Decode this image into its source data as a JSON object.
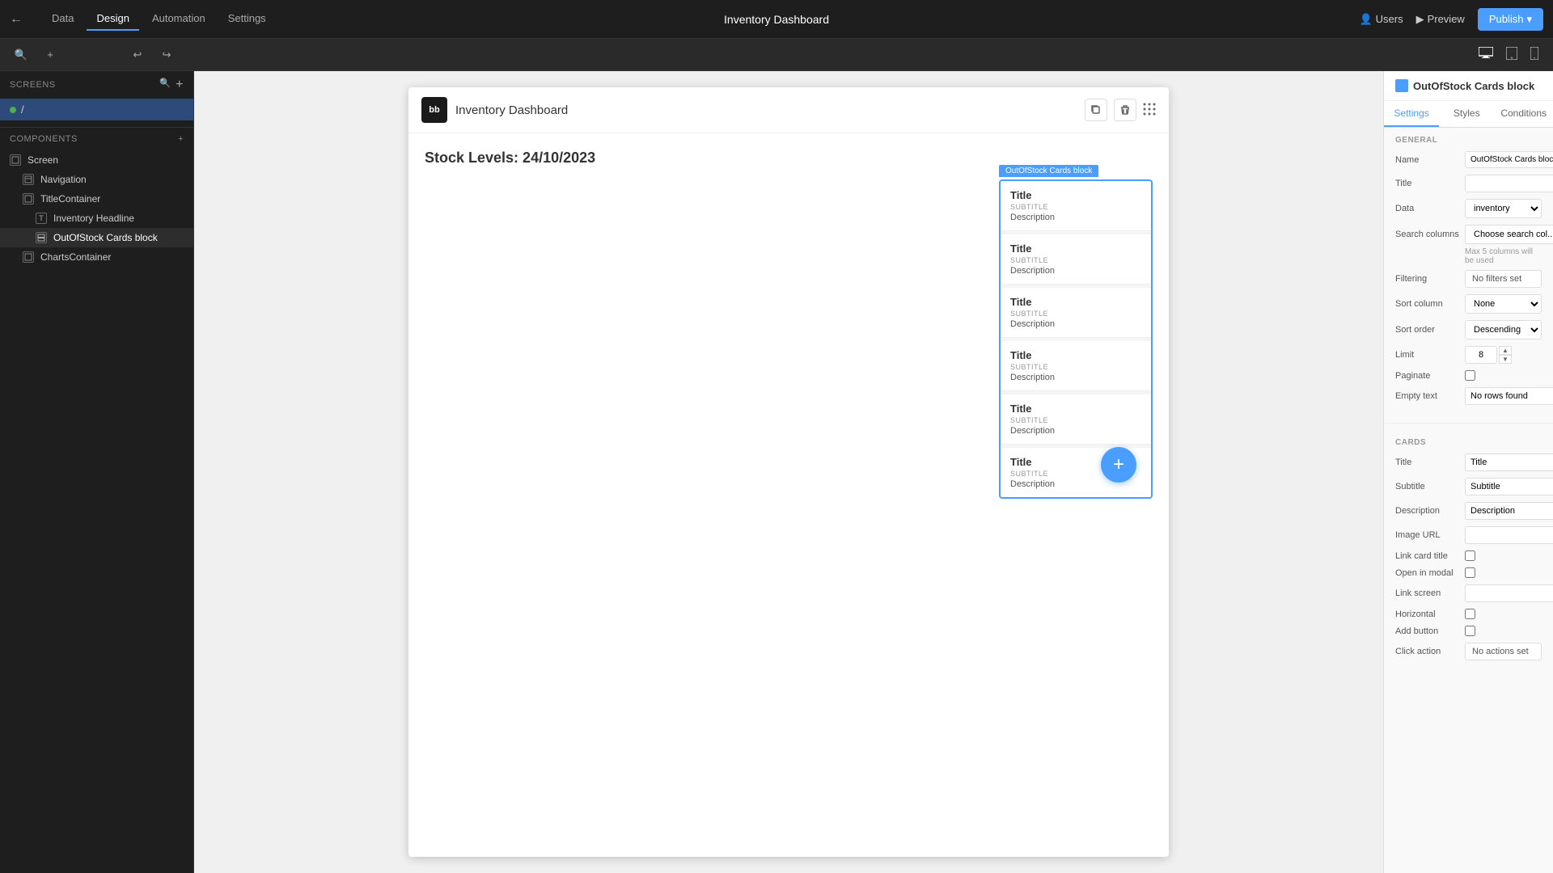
{
  "topbar": {
    "back_icon": "←",
    "tabs": [
      {
        "label": "Data",
        "active": false
      },
      {
        "label": "Design",
        "active": true
      },
      {
        "label": "Automation",
        "active": false
      },
      {
        "label": "Settings",
        "active": false
      }
    ],
    "title": "Inventory Dashboard",
    "users_label": "Users",
    "preview_label": "Preview",
    "publish_label": "Publish"
  },
  "subtoolbar": {
    "undo_icon": "↩",
    "redo_icon": "↪",
    "desktop_icon": "⬜",
    "tablet_icon": "⬜",
    "mobile_icon": "⬜"
  },
  "left_sidebar": {
    "screens_label": "Screens",
    "screen_item": "/",
    "components_label": "Components",
    "components": [
      {
        "label": "Screen",
        "indent": 0,
        "icon": "screen"
      },
      {
        "label": "Navigation",
        "indent": 1,
        "icon": "nav"
      },
      {
        "label": "TitleContainer",
        "indent": 1,
        "icon": "container"
      },
      {
        "label": "Inventory Headline",
        "indent": 2,
        "icon": "title"
      },
      {
        "label": "OutOfStock Cards block",
        "indent": 2,
        "icon": "cards",
        "active": true
      },
      {
        "label": "ChartsContainer",
        "indent": 1,
        "icon": "container"
      }
    ]
  },
  "canvas": {
    "app_title": "Inventory Dashboard",
    "app_logo": "bb",
    "stock_title": "Stock Levels: 24/10/2023",
    "cards_block_label": "OutOfStock Cards block",
    "cards": [
      {
        "title": "Title",
        "subtitle": "SUBTITLE",
        "description": "Description"
      },
      {
        "title": "Title",
        "subtitle": "SUBTITLE",
        "description": "Description"
      },
      {
        "title": "Title",
        "subtitle": "SUBTITLE",
        "description": "Description"
      },
      {
        "title": "Title",
        "subtitle": "SUBTITLE",
        "description": "Description"
      },
      {
        "title": "Title",
        "subtitle": "SUBTITLE",
        "description": "Description"
      },
      {
        "title": "Title",
        "subtitle": "SUBTITLE",
        "description": "Description"
      }
    ],
    "fab_icon": "+"
  },
  "right_panel": {
    "header_title": "OutOfStock Cards block",
    "tabs": [
      {
        "label": "Settings",
        "active": true
      },
      {
        "label": "Styles",
        "active": false
      },
      {
        "label": "Conditions",
        "active": false
      }
    ],
    "general_label": "GENERAL",
    "name_label": "Name",
    "name_value": "OutOfStock Cards block",
    "title_label": "Title",
    "title_value": "",
    "data_label": "Data",
    "data_value": "inventory",
    "search_columns_label": "Search columns",
    "search_columns_placeholder": "Choose search col...",
    "search_hint": "Max 5 columns will be used",
    "filtering_label": "Filtering",
    "filtering_value": "No filters set",
    "sort_column_label": "Sort column",
    "sort_column_value": "None",
    "sort_order_label": "Sort order",
    "sort_order_value": "Descending",
    "limit_label": "Limit",
    "limit_value": "8",
    "paginate_label": "Paginate",
    "paginate_checked": false,
    "empty_text_label": "Empty text",
    "empty_text_value": "No rows found",
    "cards_label": "CARDS",
    "card_title_label": "Title",
    "card_title_value": "Title",
    "card_subtitle_label": "Subtitle",
    "card_subtitle_value": "Subtitle",
    "card_description_label": "Description",
    "card_description_value": "Description",
    "image_url_label": "Image URL",
    "image_url_value": "",
    "link_card_title_label": "Link card title",
    "link_card_title_checked": false,
    "open_in_modal_label": "Open in modal",
    "open_in_modal_checked": false,
    "link_screen_label": "Link screen",
    "link_screen_value": "",
    "horizontal_label": "Horizontal",
    "horizontal_checked": false,
    "add_button_label": "Add button",
    "add_button_checked": false,
    "click_action_label": "Click action",
    "click_action_value": "No actions set"
  }
}
